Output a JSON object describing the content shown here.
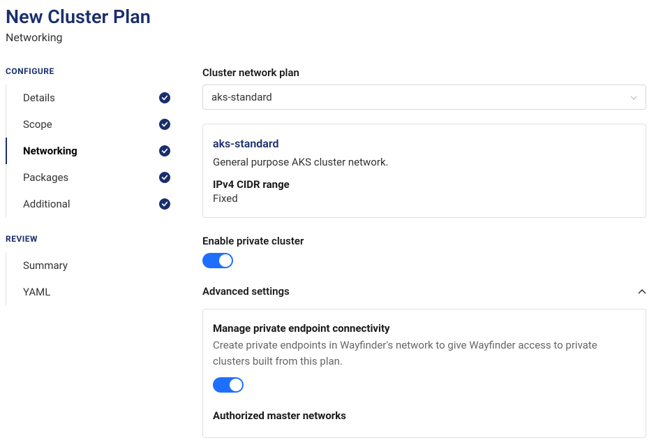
{
  "page": {
    "title": "New Cluster Plan",
    "subtitle": "Networking"
  },
  "sidebar": {
    "configure_label": "CONFIGURE",
    "review_label": "REVIEW",
    "configure_items": [
      {
        "label": "Details",
        "done": true,
        "active": false
      },
      {
        "label": "Scope",
        "done": true,
        "active": false
      },
      {
        "label": "Networking",
        "done": true,
        "active": true
      },
      {
        "label": "Packages",
        "done": true,
        "active": false
      },
      {
        "label": "Additional",
        "done": true,
        "active": false
      }
    ],
    "review_items": [
      {
        "label": "Summary"
      },
      {
        "label": "YAML"
      }
    ]
  },
  "form": {
    "network_plan_label": "Cluster network plan",
    "network_plan_value": "aks-standard",
    "info": {
      "title": "aks-standard",
      "desc": "General purpose AKS cluster network.",
      "cidr_label": "IPv4 CIDR range",
      "cidr_value": "Fixed"
    },
    "enable_private_label": "Enable private cluster",
    "enable_private_value": true,
    "advanced_label": "Advanced settings",
    "advanced": {
      "manage_title": "Manage private endpoint connectivity",
      "manage_desc": "Create private endpoints in Wayfinder's network to give Wayfinder access to private clusters built from this plan.",
      "manage_value": true,
      "authorized_title": "Authorized master networks"
    }
  }
}
